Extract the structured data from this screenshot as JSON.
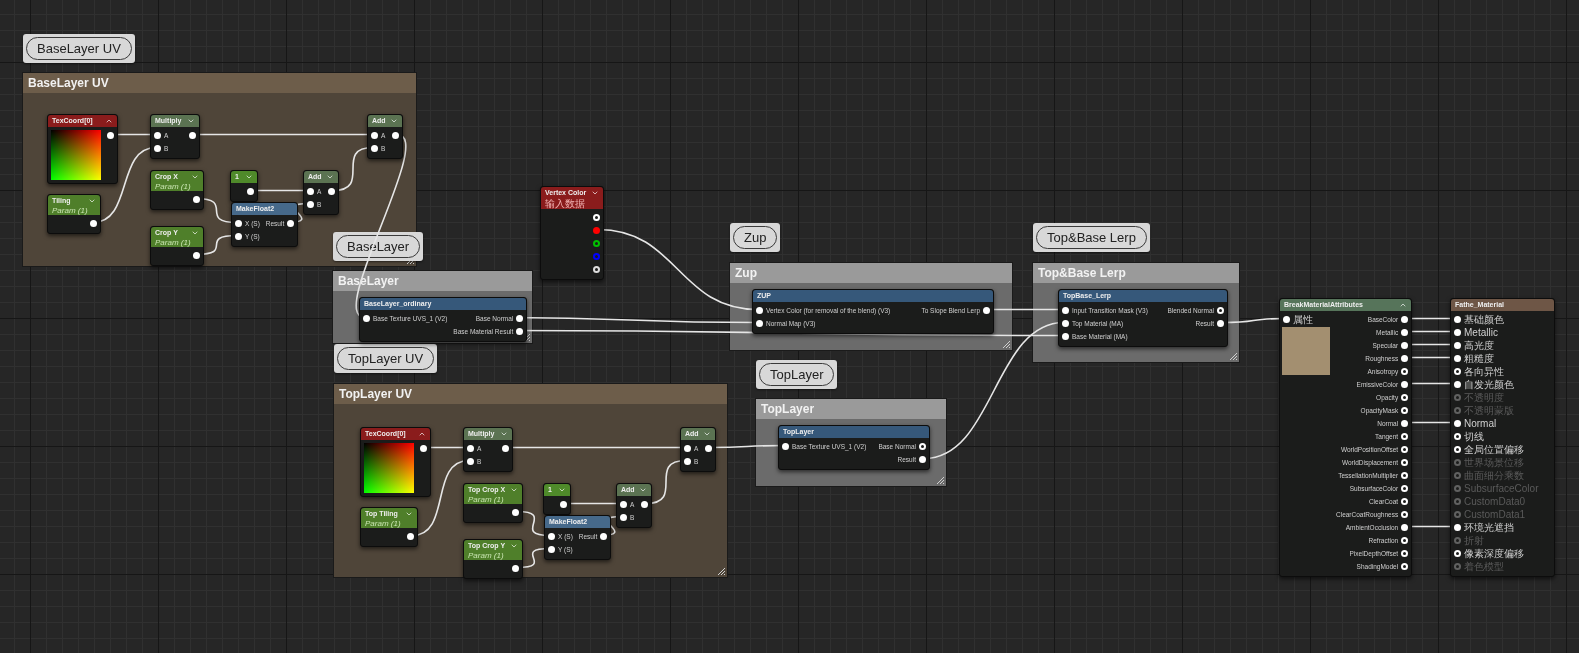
{
  "comments": [
    {
      "title": "BaseLayer UV",
      "bubble": "BaseLayer UV",
      "color": "#6d5d4a"
    },
    {
      "title": "BaseLayer",
      "bubble": "BaseLayer",
      "color": "#9a9a9a"
    },
    {
      "title": "Zup",
      "bubble": "Zup",
      "color": "#9a9a9a"
    },
    {
      "title": "Top&Base Lerp",
      "bubble": "Top&Base Lerp",
      "color": "#9a9a9a"
    },
    {
      "title": "TopLayer UV",
      "bubble": "TopLayer UV",
      "color": "#6d5d4a"
    },
    {
      "title": "TopLayer",
      "bubble": "TopLayer",
      "color": "#9a9a9a"
    }
  ],
  "nodes": [
    {
      "title": "TexCoord[0]",
      "color": "#8a1c1c",
      "kind": "uv-preview",
      "expanded": true,
      "outputs": [
        {
          "connected": true
        }
      ]
    },
    {
      "title": "Multiply",
      "color": "#5b7352",
      "kind": "plain",
      "expanded": false,
      "inputs": [
        {
          "label": "A",
          "connected": true
        },
        {
          "label": "B",
          "connected": true
        }
      ],
      "outputs": [
        {
          "connected": true
        }
      ]
    },
    {
      "title": "Add",
      "color": "#5b7352",
      "kind": "plain",
      "expanded": false,
      "inputs": [
        {
          "label": "A",
          "connected": true
        },
        {
          "label": "B",
          "connected": true
        }
      ],
      "outputs": [
        {
          "connected": true
        }
      ]
    },
    {
      "title": "Tiling",
      "subtitle": "Param (1)",
      "color": "#4f7f2a",
      "kind": "plain",
      "expanded": false,
      "outputs": [
        {
          "connected": true
        }
      ]
    },
    {
      "title": "Crop X",
      "subtitle": "Param (1)",
      "color": "#4f7f2a",
      "kind": "plain",
      "expanded": false,
      "outputs": [
        {
          "connected": true
        }
      ]
    },
    {
      "title": "1",
      "color": "#4f8a2a",
      "kind": "plain",
      "expanded": false,
      "outputs": [
        {
          "connected": true
        }
      ]
    },
    {
      "title": "Add",
      "color": "#5b7352",
      "kind": "plain",
      "expanded": false,
      "inputs": [
        {
          "label": "A",
          "connected": true
        },
        {
          "label": "B",
          "connected": true
        }
      ],
      "outputs": [
        {
          "connected": true
        }
      ]
    },
    {
      "title": "Crop Y",
      "subtitle": "Param (1)",
      "color": "#4f7f2a",
      "kind": "plain",
      "expanded": false,
      "outputs": [
        {
          "connected": true
        }
      ]
    },
    {
      "title": "MakeFloat2",
      "color": "#46698a",
      "kind": "plain",
      "inputs": [
        {
          "label": "X (S)",
          "connected": true
        },
        {
          "label": "Y (S)",
          "connected": true
        }
      ],
      "outputs": [
        {
          "label": "Result",
          "connected": true
        }
      ]
    },
    {
      "title": "Vertex Color",
      "subtitle": "输入数据",
      "color": "#8a1c1c",
      "kind": "plain",
      "expanded": false,
      "outputs": [
        {
          "connected": false,
          "color": "#ffffff"
        },
        {
          "connected": true,
          "color": "#ff0000"
        },
        {
          "connected": false,
          "color": "#00c000"
        },
        {
          "connected": false,
          "color": "#0000ff"
        },
        {
          "connected": false,
          "color": "#dddddd"
        }
      ]
    },
    {
      "title": "BaseLayer_ordinary",
      "color": "#36587a",
      "kind": "plain",
      "inputs": [
        {
          "label": "Base Texture UVS_1 (V2)",
          "connected": true
        }
      ],
      "outputs": [
        {
          "label": "Base Normal",
          "connected": true
        },
        {
          "label": "Base Material Result",
          "connected": true
        }
      ]
    },
    {
      "title": "ZUP",
      "color": "#36587a",
      "kind": "plain",
      "inputs": [
        {
          "label": "Vertex Color (for removal of the blend) (V3)",
          "connected": true
        },
        {
          "label": "Normal Map (V3)",
          "connected": true
        }
      ],
      "outputs": [
        {
          "label": "To Slope Blend Lerp",
          "connected": true
        }
      ]
    },
    {
      "title": "TopBase_Lerp",
      "color": "#36587a",
      "kind": "plain",
      "inputs": [
        {
          "label": "Input Transition Mask (V3)",
          "connected": true
        },
        {
          "label": "Top Material (MA)",
          "connected": true
        },
        {
          "label": "Base Material (MA)",
          "connected": true
        }
      ],
      "outputs": [
        {
          "label": "Blended Normal",
          "connected": false
        },
        {
          "label": "Result",
          "connected": true
        }
      ]
    },
    {
      "title": "TexCoord[0]",
      "color": "#8a1c1c",
      "kind": "uv-preview",
      "expanded": true,
      "outputs": [
        {
          "connected": true
        }
      ]
    },
    {
      "title": "Multiply",
      "color": "#5b7352",
      "kind": "plain",
      "expanded": false,
      "inputs": [
        {
          "label": "A",
          "connected": true
        },
        {
          "label": "B",
          "connected": true
        }
      ],
      "outputs": [
        {
          "connected": true
        }
      ]
    },
    {
      "title": "Add",
      "color": "#5b7352",
      "kind": "plain",
      "expanded": false,
      "inputs": [
        {
          "label": "A",
          "connected": true
        },
        {
          "label": "B",
          "connected": true
        }
      ],
      "outputs": [
        {
          "connected": true
        }
      ]
    },
    {
      "title": "Top Tiling",
      "subtitle": "Param (1)",
      "color": "#4f7f2a",
      "kind": "plain",
      "expanded": false,
      "outputs": [
        {
          "connected": true
        }
      ]
    },
    {
      "title": "Top Crop X",
      "subtitle": "Param (1)",
      "color": "#4f7f2a",
      "kind": "plain",
      "expanded": false,
      "outputs": [
        {
          "connected": true
        }
      ]
    },
    {
      "title": "1",
      "color": "#4f8a2a",
      "kind": "plain",
      "expanded": false,
      "outputs": [
        {
          "connected": true
        }
      ]
    },
    {
      "title": "Add",
      "color": "#5b7352",
      "kind": "plain",
      "expanded": false,
      "inputs": [
        {
          "label": "A",
          "connected": true
        },
        {
          "label": "B",
          "connected": true
        }
      ],
      "outputs": [
        {
          "connected": true
        }
      ]
    },
    {
      "title": "Top Crop Y",
      "subtitle": "Param (1)",
      "color": "#4f7f2a",
      "kind": "plain",
      "expanded": false,
      "outputs": [
        {
          "connected": true
        }
      ]
    },
    {
      "title": "MakeFloat2",
      "color": "#46698a",
      "kind": "plain",
      "inputs": [
        {
          "label": "X (S)",
          "connected": true
        },
        {
          "label": "Y (S)",
          "connected": true
        }
      ],
      "outputs": [
        {
          "label": "Result",
          "connected": true
        }
      ]
    },
    {
      "title": "TopLayer",
      "color": "#36587a",
      "kind": "plain",
      "inputs": [
        {
          "label": "Base Texture UVS_1 (V2)",
          "connected": true
        }
      ],
      "outputs": [
        {
          "label": "Base Normal",
          "connected": false
        },
        {
          "label": "Result",
          "connected": true
        }
      ]
    },
    {
      "title": "BreakMaterialAttributes",
      "color": "#56745a",
      "kind": "texture-preview",
      "expanded": true,
      "inputs": [
        {
          "label": "属性",
          "connected": true
        }
      ],
      "outputs": [
        {
          "label": "BaseColor",
          "connected": true
        },
        {
          "label": "Metallic",
          "connected": true
        },
        {
          "label": "Specular",
          "connected": true
        },
        {
          "label": "Roughness",
          "connected": true
        },
        {
          "label": "Anisotropy",
          "connected": false
        },
        {
          "label": "EmissiveColor",
          "connected": true
        },
        {
          "label": "Opacity",
          "connected": false
        },
        {
          "label": "OpacityMask",
          "connected": false
        },
        {
          "label": "Normal",
          "connected": true
        },
        {
          "label": "Tangent",
          "connected": false
        },
        {
          "label": "WorldPositionOffset",
          "connected": false
        },
        {
          "label": "WorldDisplacement",
          "connected": false
        },
        {
          "label": "TessellationMultiplier",
          "connected": false
        },
        {
          "label": "SubsurfaceColor",
          "connected": false
        },
        {
          "label": "ClearCoat",
          "connected": false
        },
        {
          "label": "ClearCoatRoughness",
          "connected": false
        },
        {
          "label": "AmbientOcclusion",
          "connected": true
        },
        {
          "label": "Refraction",
          "connected": false
        },
        {
          "label": "PixelDepthOffset",
          "connected": false
        },
        {
          "label": "ShadingModel",
          "connected": false
        }
      ]
    },
    {
      "title": "Fathe_Material",
      "color": "#6e5646",
      "kind": "plain",
      "inputs": [
        {
          "label": "基础颜色",
          "connected": true,
          "disabled": false
        },
        {
          "label": "Metallic",
          "connected": true,
          "disabled": false
        },
        {
          "label": "高光度",
          "connected": true,
          "disabled": false
        },
        {
          "label": "粗糙度",
          "connected": true,
          "disabled": false
        },
        {
          "label": "各向异性",
          "connected": false,
          "disabled": false
        },
        {
          "label": "自发光颜色",
          "connected": true,
          "disabled": false
        },
        {
          "label": "不透明度",
          "connected": false,
          "disabled": true
        },
        {
          "label": "不透明蒙版",
          "connected": false,
          "disabled": true
        },
        {
          "label": "Normal",
          "connected": true,
          "disabled": false
        },
        {
          "label": "切线",
          "connected": false,
          "disabled": false
        },
        {
          "label": "全局位置偏移",
          "connected": false,
          "disabled": false
        },
        {
          "label": "世界场景位移",
          "connected": false,
          "disabled": true
        },
        {
          "label": "曲面细分乘数",
          "connected": false,
          "disabled": true
        },
        {
          "label": "SubsurfaceColor",
          "connected": false,
          "disabled": true
        },
        {
          "label": "CustomData0",
          "connected": false,
          "disabled": true
        },
        {
          "label": "CustomData1",
          "connected": false,
          "disabled": true
        },
        {
          "label": "环境光遮挡",
          "connected": true,
          "disabled": false
        },
        {
          "label": "折射",
          "connected": false,
          "disabled": true
        },
        {
          "label": "像素深度偏移",
          "connected": false,
          "disabled": false
        },
        {
          "label": "着色模型",
          "connected": false,
          "disabled": true
        }
      ]
    }
  ]
}
